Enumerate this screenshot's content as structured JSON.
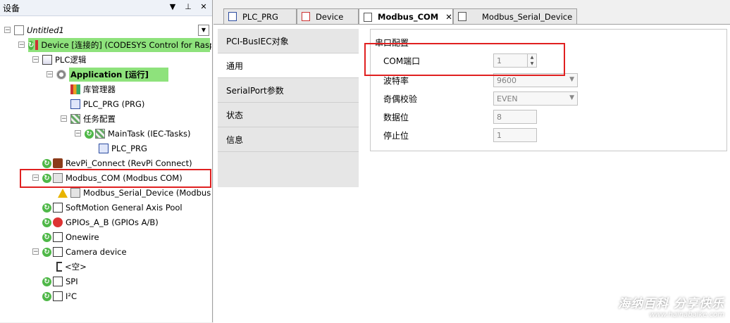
{
  "devices_panel": {
    "title": "设备",
    "controls": [
      "▼",
      "⊥",
      "✕"
    ]
  },
  "tree": [
    {
      "label": "Untitled1",
      "italic": true,
      "icon": "document-icon"
    },
    {
      "label": "Device [连接的] (CODESYS Control for Raspb",
      "icon": "device-icon",
      "highlight": true
    },
    {
      "label": "PLC逻辑",
      "icon": "plc-logic-icon"
    },
    {
      "label": "Application [运行]",
      "icon": "gear-icon",
      "highlight": true,
      "bold": true
    },
    {
      "label": "库管理器",
      "icon": "library-icon"
    },
    {
      "label": "PLC_PRG (PRG)",
      "icon": "program-icon"
    },
    {
      "label": "任务配置",
      "icon": "task-config-icon"
    },
    {
      "label": "MainTask (IEC-Tasks)",
      "icon": "task-icon"
    },
    {
      "label": "PLC_PRG",
      "icon": "program-call-icon"
    },
    {
      "label": "RevPi_Connect (RevPi Connect)",
      "icon": "revpi-icon"
    },
    {
      "label": "Modbus_COM (Modbus COM)",
      "icon": "module-icon"
    },
    {
      "label": "Modbus_Serial_Device (Modbus Serial",
      "icon": "module-icon"
    },
    {
      "label": "SoftMotion General Axis Pool",
      "icon": "axis-icon"
    },
    {
      "label": "GPIOs_A_B (GPIOs A/B)",
      "icon": "gpio-icon"
    },
    {
      "label": "Onewire",
      "icon": "connector-icon"
    },
    {
      "label": "Camera device",
      "icon": "connector-icon"
    },
    {
      "label": "<空>",
      "icon": "plug-icon"
    },
    {
      "label": "SPI",
      "icon": "connector-icon"
    },
    {
      "label": "I²C",
      "icon": "connector-icon"
    }
  ],
  "tabs": [
    {
      "label": "PLC_PRG",
      "active": false
    },
    {
      "label": "Device",
      "active": false
    },
    {
      "label": "Modbus_COM",
      "active": true,
      "close": "✕"
    },
    {
      "label": "Modbus_Serial_Device",
      "active": false
    }
  ],
  "side_tabs": [
    {
      "label": "PCI-BusIEC对象",
      "selected": false
    },
    {
      "label": "通用",
      "selected": true
    },
    {
      "label": "SerialPort参数",
      "selected": false
    },
    {
      "label": "状态",
      "selected": false
    },
    {
      "label": "信息",
      "selected": false
    }
  ],
  "serial_config": {
    "group_title": "串口配置",
    "fields": [
      {
        "label": "COM端口",
        "value": "1",
        "control": "spinner"
      },
      {
        "label": "波特率",
        "value": "9600",
        "control": "dropdown"
      },
      {
        "label": "奇偶校验",
        "value": "EVEN",
        "control": "dropdown"
      },
      {
        "label": "数据位",
        "value": "8",
        "control": "text"
      },
      {
        "label": "停止位",
        "value": "1",
        "control": "text"
      }
    ]
  },
  "watermark": {
    "line1": "海纳百科 分享快乐",
    "line2": "www.hainabaike.com"
  },
  "colors": {
    "highlight": "#8ee27c",
    "annotation": "#e02020",
    "status_ok": "#4fb848"
  }
}
